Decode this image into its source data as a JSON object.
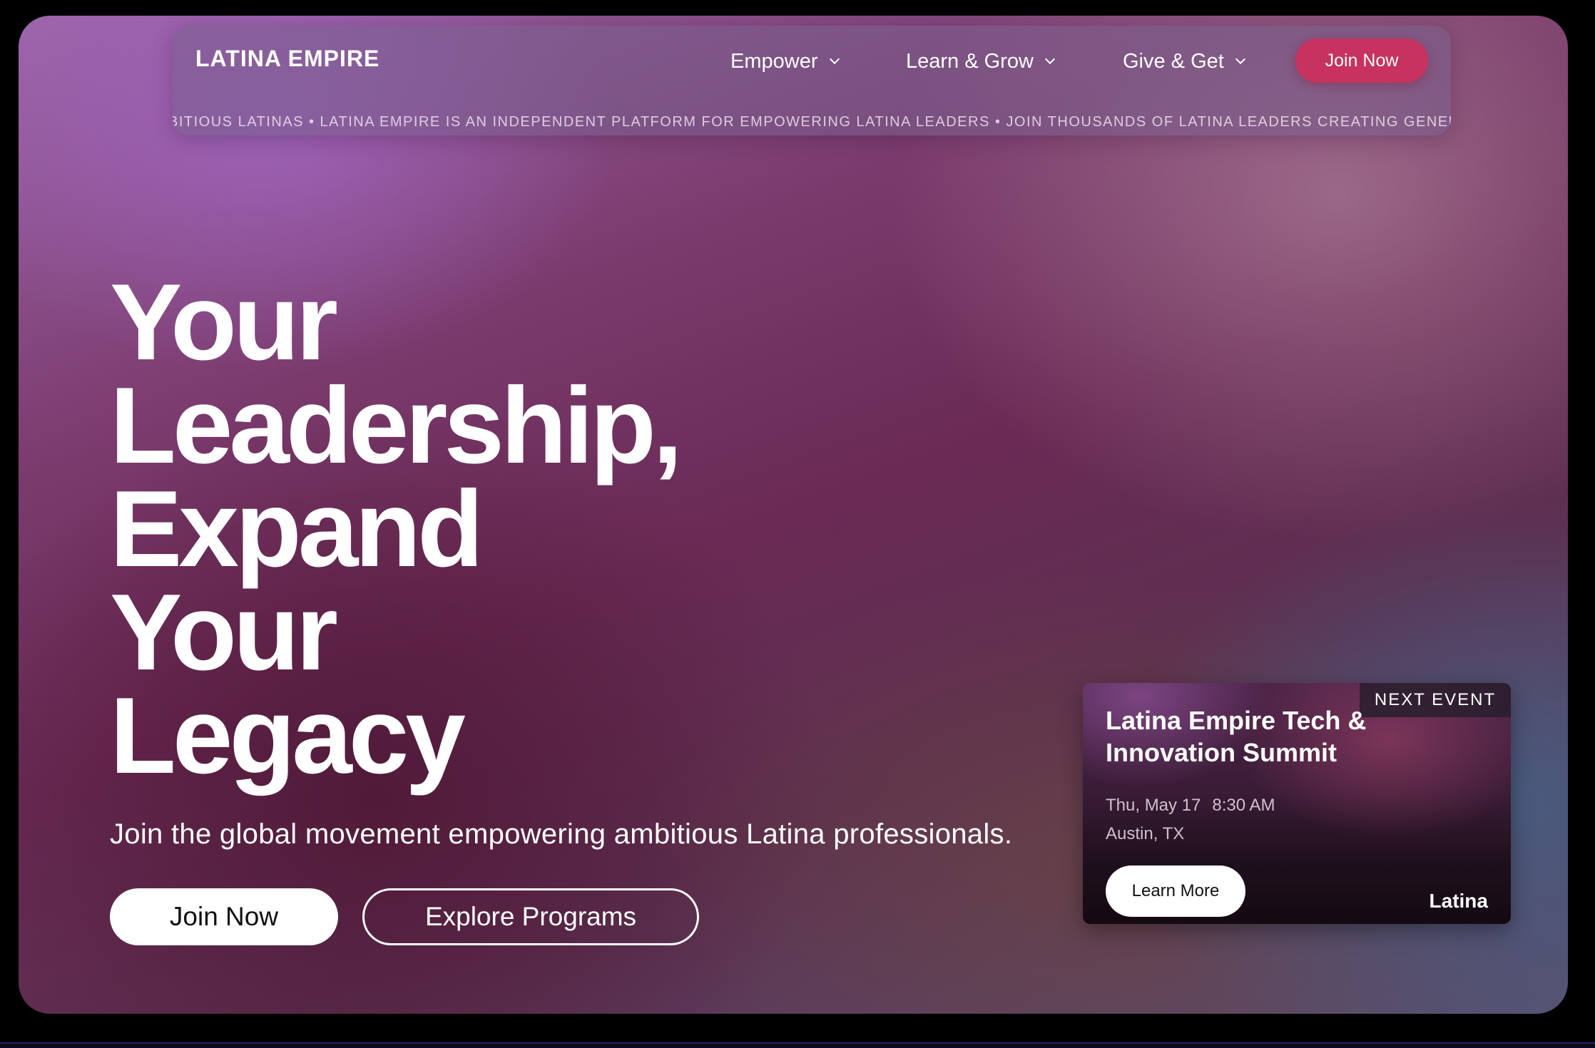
{
  "nav": {
    "brand": "LATINA EMPIRE",
    "items": [
      {
        "label": "Empower"
      },
      {
        "label": "Learn & Grow"
      },
      {
        "label": "Give & Get"
      }
    ],
    "cta_label": "Join Now",
    "ticker": "BITIOUS LATINAS • LATINA EMPIRE IS AN INDEPENDENT PLATFORM FOR EMPOWERING LATINA LEADERS • JOIN THOUSANDS OF LATINA LEADERS CREATING GENERATIO"
  },
  "hero": {
    "headline_lines": [
      "Your",
      "Leadership,",
      "Expand",
      "Your",
      "Legacy"
    ],
    "subtitle": "Join the global movement empowering ambitious Latina professionals.",
    "primary_button": "Join Now",
    "secondary_button": "Explore Programs"
  },
  "event": {
    "badge": "NEXT EVENT",
    "title": "Latina Empire Tech & Innovation Summit",
    "date": "Thu, May 17",
    "time": "8:30 AM",
    "location": "Austin, TX",
    "button": "Learn More",
    "brand": "Latina"
  },
  "colors": {
    "accent": "#c7325e",
    "text": "#ffffff",
    "page_background": "#000000"
  },
  "icons": {
    "dropdown": "chevron-down-icon"
  }
}
